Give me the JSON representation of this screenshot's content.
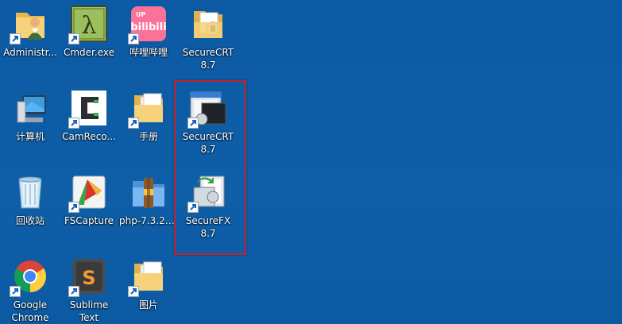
{
  "desktop": {
    "background_color": "#0d5ca4",
    "highlight_color": "#c0232c",
    "icons": [
      {
        "id": "administrator",
        "label": "Administr...",
        "icon": "user-folder-icon"
      },
      {
        "id": "cmder",
        "label": "Cmder.exe",
        "icon": "lambda-icon"
      },
      {
        "id": "bilibili",
        "label": "哔哩哔哩",
        "icon": "bilibili-icon"
      },
      {
        "id": "securecrt-folder",
        "label": "SecureCRT 8.7",
        "icon": "folder-icon"
      },
      {
        "id": "computer",
        "label": "计算机",
        "icon": "computer-icon"
      },
      {
        "id": "camrecorder",
        "label": "CamReco...",
        "icon": "camtasia-icon"
      },
      {
        "id": "manual",
        "label": "手册",
        "icon": "folder-icon"
      },
      {
        "id": "securecrt",
        "label": "SecureCRT 8.7",
        "icon": "securecrt-icon"
      },
      {
        "id": "recycle-bin",
        "label": "回收站",
        "icon": "recycle-bin-icon"
      },
      {
        "id": "fscapture",
        "label": "FSCapture",
        "icon": "fscapture-icon"
      },
      {
        "id": "php",
        "label": "php-7.3.25...",
        "icon": "winrar-icon"
      },
      {
        "id": "securefx",
        "label": "SecureFX 8.7",
        "icon": "securefx-icon"
      },
      {
        "id": "chrome",
        "label": "Google Chrome",
        "icon": "chrome-icon"
      },
      {
        "id": "sublime",
        "label": "Sublime Text",
        "icon": "sublime-icon"
      },
      {
        "id": "pictures",
        "label": "图片",
        "icon": "folder-icon"
      }
    ]
  }
}
